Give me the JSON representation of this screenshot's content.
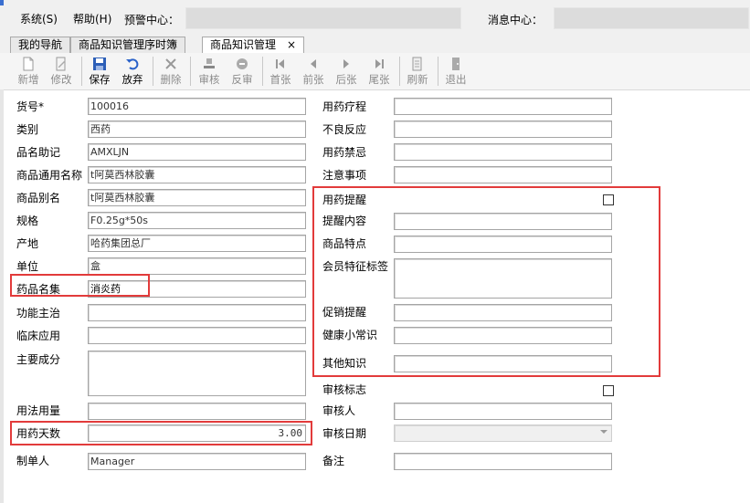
{
  "menu": {
    "system": "系统(S)",
    "help": "帮助(H)",
    "warning_center": "预警中心：",
    "message_center": "消息中心："
  },
  "tabs": [
    {
      "label": "我的导航"
    },
    {
      "label": "商品知识管理序时簿"
    },
    {
      "label": "商品知识管理",
      "close": "×"
    }
  ],
  "toolbar": {
    "new": "新增",
    "edit": "修改",
    "save": "保存",
    "discard": "放弃",
    "delete": "删除",
    "audit": "审核",
    "unaudit": "反审",
    "first": "首张",
    "prev": "前张",
    "next": "后张",
    "last": "尾张",
    "refresh": "刷新",
    "exit": "退出"
  },
  "form": {
    "item_no": {
      "label": "货号*",
      "value": "100016"
    },
    "category": {
      "label": "类别",
      "value": "西药"
    },
    "mnemonic": {
      "label": "品名助记",
      "value": "AMXLJN"
    },
    "generic_name": {
      "label": "商品通用名称",
      "value": "t阿莫西林胶囊"
    },
    "alias": {
      "label": "商品别名",
      "value": "t阿莫西林胶囊"
    },
    "spec": {
      "label": "规格",
      "value": "F0.25g*50s"
    },
    "origin": {
      "label": "产地",
      "value": "哈药集团总厂"
    },
    "unit": {
      "label": "单位",
      "value": "盒"
    },
    "drug_collection": {
      "label": "药品名集",
      "value": "消炎药"
    },
    "indications": {
      "label": "功能主治",
      "value": ""
    },
    "clinical_use": {
      "label": "临床应用",
      "value": ""
    },
    "ingredients": {
      "label": "主要成分",
      "value": ""
    },
    "usage_dosage": {
      "label": "用法用量",
      "value": ""
    },
    "medication_days": {
      "label": "用药天数",
      "value": "3.00"
    },
    "creator": {
      "label": "制单人",
      "value": "Manager"
    },
    "course": {
      "label": "用药疗程",
      "value": ""
    },
    "adverse": {
      "label": "不良反应",
      "value": ""
    },
    "contraindication": {
      "label": "用药禁忌",
      "value": ""
    },
    "precautions": {
      "label": "注意事项",
      "value": ""
    },
    "reminder": {
      "label": "用药提醒",
      "checked": false
    },
    "reminder_content": {
      "label": "提醒内容",
      "value": ""
    },
    "features": {
      "label": "商品特点",
      "value": ""
    },
    "member_tags": {
      "label": "会员特征标签",
      "value": ""
    },
    "promo_reminder": {
      "label": "促销提醒",
      "value": ""
    },
    "health_tips": {
      "label": "健康小常识",
      "value": ""
    },
    "other_knowledge": {
      "label": "其他知识",
      "value": ""
    },
    "audit_flag": {
      "label": "审核标志",
      "checked": false
    },
    "auditor": {
      "label": "审核人",
      "value": ""
    },
    "audit_date": {
      "label": "审核日期",
      "value": ""
    },
    "remarks": {
      "label": "备注",
      "value": ""
    }
  },
  "colors": {
    "highlight": "#e23b3b",
    "menubar": "#f0f0f0",
    "field_border": "#a5a5a5"
  }
}
